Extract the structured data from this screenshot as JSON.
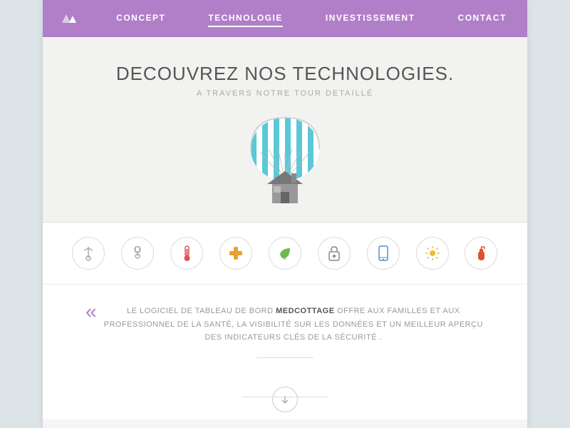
{
  "nav": {
    "logo_alt": "MedCottage Logo",
    "links": [
      {
        "label": "CONCEPT",
        "active": false
      },
      {
        "label": "TECHNOLOGIE",
        "active": true
      },
      {
        "label": "INVESTISSEMENT",
        "active": false
      },
      {
        "label": "CONTACT",
        "active": false
      }
    ]
  },
  "hero": {
    "title": "DECOUVREZ NOS TECHNOLOGIES.",
    "subtitle": "A TRAVERS NOTRE TOUR DETAILLÉ"
  },
  "icons": [
    {
      "name": "antenna-icon",
      "color": "#999"
    },
    {
      "name": "plug-icon",
      "color": "#999"
    },
    {
      "name": "thermometer-icon",
      "color": "#e05050"
    },
    {
      "name": "medical-icon",
      "color": "#e8a030"
    },
    {
      "name": "leaf-icon",
      "color": "#70b850"
    },
    {
      "name": "lock-icon",
      "color": "#888"
    },
    {
      "name": "phone-icon",
      "color": "#5090d0"
    },
    {
      "name": "sun-icon",
      "color": "#e8c030"
    },
    {
      "name": "fire-icon",
      "color": "#e05030"
    }
  ],
  "quote": {
    "mark": "«",
    "text_before": "LE LOGICIEL DE TABLEAU DE BORD ",
    "brand": "MEDCOTTAGE",
    "text_after": " OFFRE AUX FAMILLES ET AUX PROFESSIONNEL DE LA SANTÉ, LA VISIBILITÉ SUR LES DONNÉES ET UN MEILLEUR APERÇU DES INDICATEURS CLÉS DE LA SÉCURITÉ ."
  },
  "colors": {
    "nav_bg": "#b07fc8",
    "accent": "#b07fc8",
    "parachute_stripe1": "#5bc8d8",
    "parachute_stripe2": "#fff",
    "house_color": "#888"
  }
}
